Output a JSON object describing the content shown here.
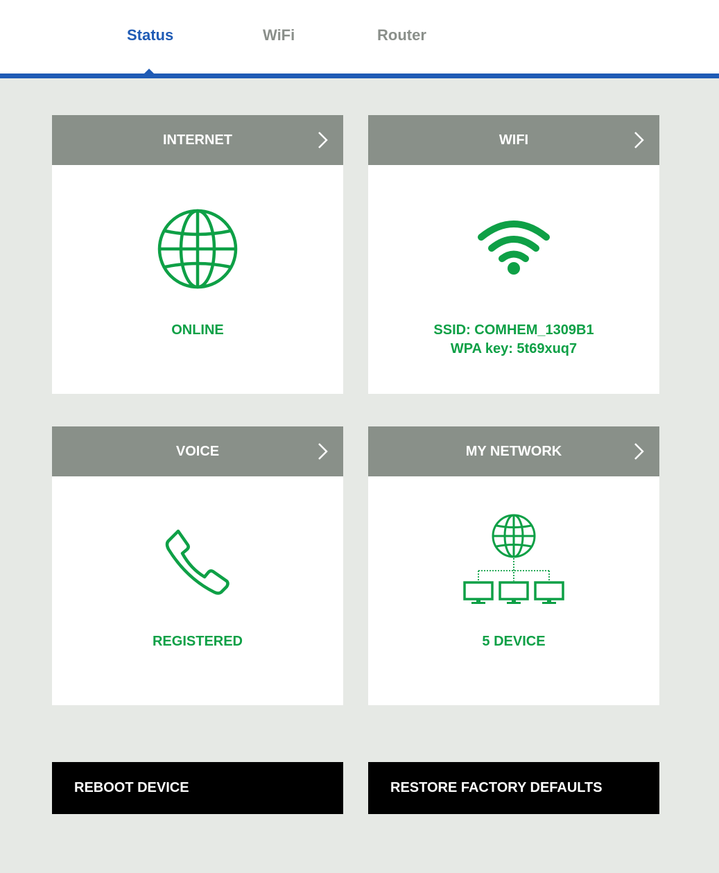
{
  "nav": {
    "tabs": [
      {
        "label": "Status",
        "active": true
      },
      {
        "label": "WiFi",
        "active": false
      },
      {
        "label": "Router",
        "active": false
      }
    ]
  },
  "colors": {
    "accent_blue": "#1f5bb5",
    "status_green": "#0ea046",
    "header_gray": "#899089",
    "background": "#e6e9e5"
  },
  "cards": {
    "internet": {
      "title": "INTERNET",
      "icon": "globe-icon",
      "status": "ONLINE"
    },
    "wifi": {
      "title": "WIFI",
      "icon": "wifi-icon",
      "ssid": "SSID: COMHEM_1309B1",
      "wpa": "WPA key: 5t69xuq7"
    },
    "voice": {
      "title": "VOICE",
      "icon": "phone-icon",
      "status": "REGISTERED"
    },
    "network": {
      "title": "MY NETWORK",
      "icon": "network-icon",
      "status": "5 DEVICE"
    }
  },
  "actions": {
    "reboot_label": "REBOOT DEVICE",
    "restore_label": "RESTORE FACTORY DEFAULTS"
  }
}
